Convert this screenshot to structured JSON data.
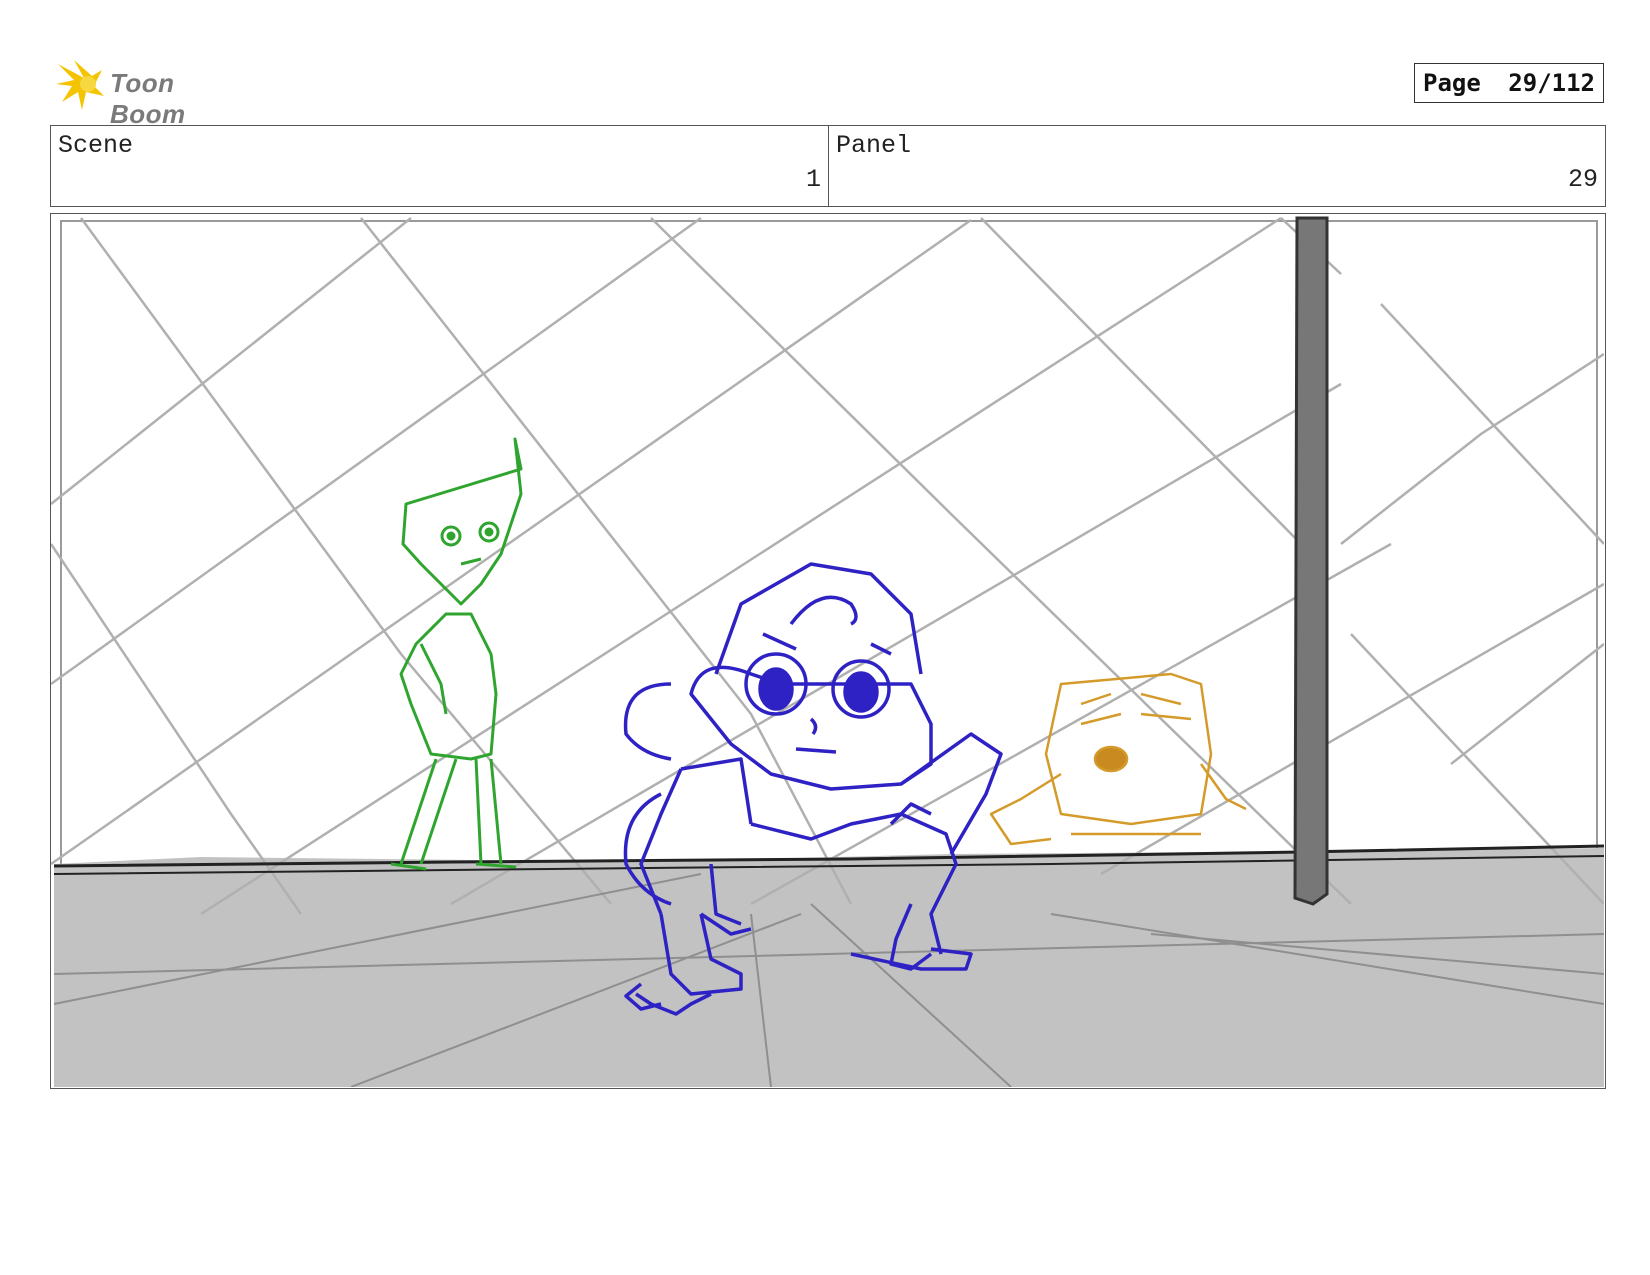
{
  "header": {
    "logo_text": "Toon Boom",
    "page_label": "Page",
    "page_number": "29/112"
  },
  "info": {
    "scene_label": "Scene",
    "scene_value": "1",
    "panel_label": "Panel",
    "panel_value": "29"
  },
  "colors": {
    "character_green": "#2fa52f",
    "character_blue": "#2e22c4",
    "character_gold": "#d49a2a",
    "floor_gray": "#c0c0c0",
    "fence_gray": "#b3b3b3",
    "pole_gray": "#7a7a7a"
  }
}
